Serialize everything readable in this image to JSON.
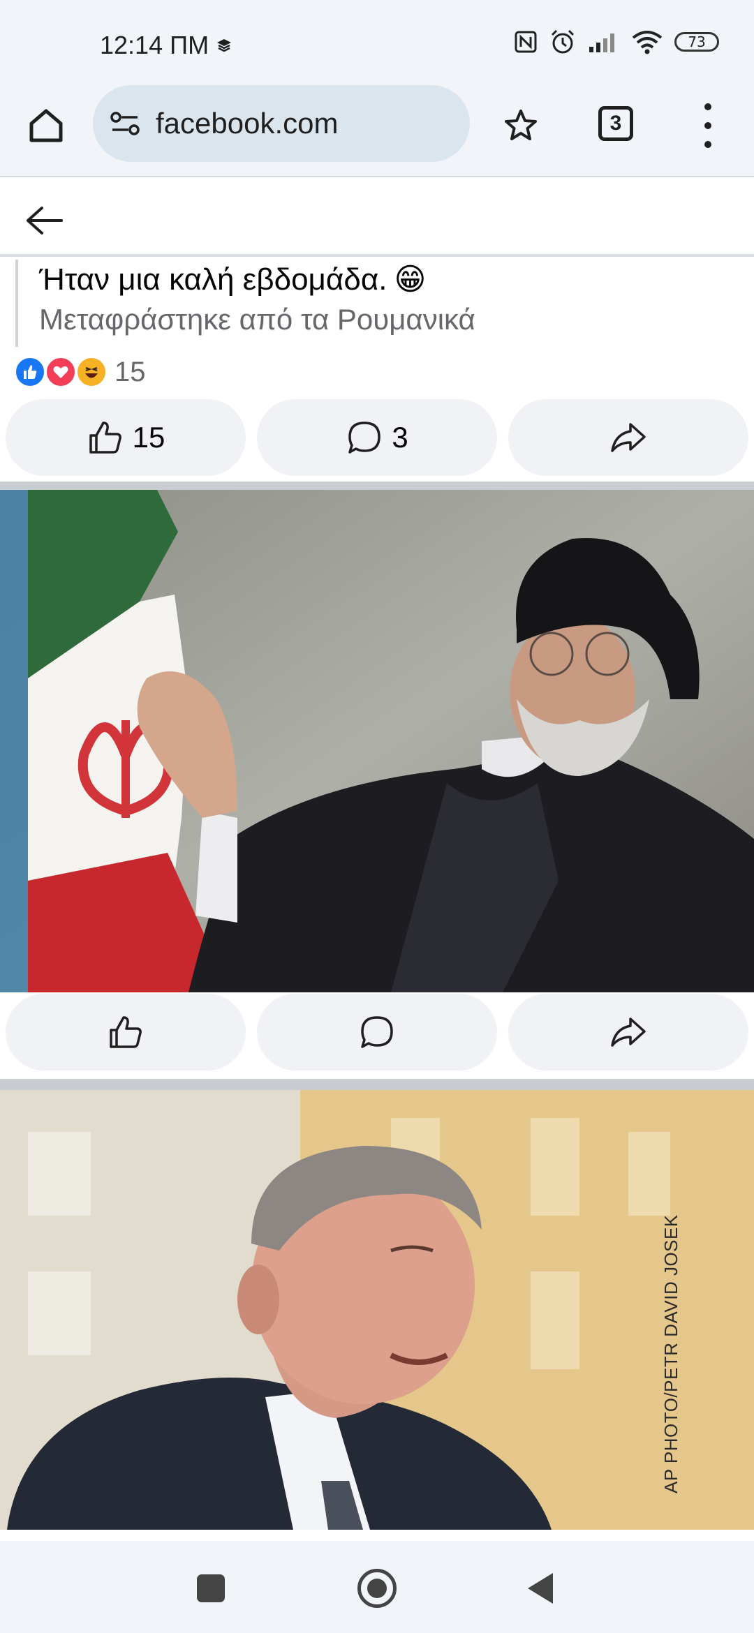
{
  "status_bar": {
    "time": "12:14 ΠΜ",
    "battery": "73"
  },
  "browser": {
    "url": "facebook.com",
    "tab_count": "3"
  },
  "post1": {
    "text": "Ήταν μια καλή εβδομάδα.",
    "emoji": "😁",
    "translated_note": "Μεταφράστηκε από τα Ρουμανικά",
    "reaction_count": "15",
    "like_count": "15",
    "comment_count": "3"
  },
  "post3": {
    "photo_credit": "AP PHOTO/PETR DAVID JOSEK"
  },
  "colors": {
    "fb_blue": "#1877f2",
    "love_red": "#f33e58",
    "haha_yellow": "#f7b125",
    "button_bg": "#f0f2f5"
  },
  "icons": [
    "home-icon",
    "site-settings-icon",
    "star-icon",
    "tabs-icon",
    "more-vert-icon",
    "back-arrow-icon",
    "like-icon",
    "comment-icon",
    "share-icon"
  ]
}
